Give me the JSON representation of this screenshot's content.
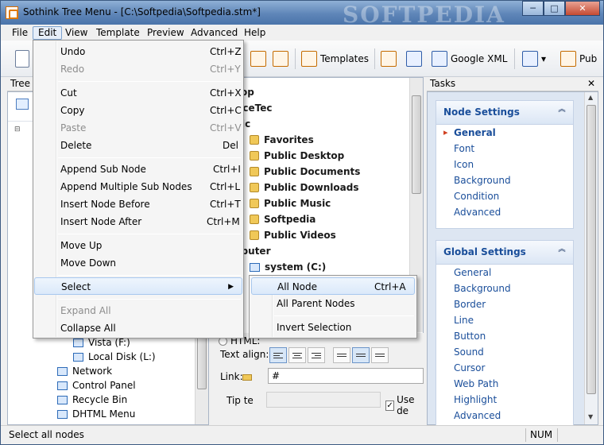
{
  "window": {
    "title": "Sothink Tree Menu - [C:\\Softpedia\\Softpedia.stm*]",
    "watermark": "SOFTPEDIA",
    "minimize": "─",
    "maximize": "□",
    "close": "✕"
  },
  "menubar": [
    "File",
    "Edit",
    "View",
    "Template",
    "Preview",
    "Advanced",
    "Help"
  ],
  "toolbar": {
    "templates_label": "Templates",
    "google_xml_label": "Google XML",
    "publish_label": "Pub",
    "dropdown_glyph": "▾"
  },
  "tree_panel": {
    "title": "Tree",
    "rows": [
      {
        "label": "Vista (F:)"
      },
      {
        "label": "Local Disk (L:)"
      },
      {
        "label": "Network"
      },
      {
        "label": "Control Panel"
      },
      {
        "label": "Recycle Bin"
      },
      {
        "label": "DHTML Menu"
      }
    ]
  },
  "preview_tree": {
    "rows": [
      "esktop",
      "SourceTec",
      "Public",
      "Favorites",
      "Public Desktop",
      "Public Documents",
      "Public Downloads",
      "Public Music",
      "Softpedia",
      "Public Videos",
      "Computer",
      "system (C:)"
    ]
  },
  "properties": {
    "html_label": "HTML:",
    "text_align_label": "Text align:",
    "link_label": "Link:",
    "link_value": "#",
    "tip_label": "Tip te",
    "use_default_label": "Use de"
  },
  "tasks_panel": {
    "title": "Tasks",
    "close": "✕",
    "node_settings": {
      "title": "Node Settings",
      "collapse": "︽",
      "items": [
        "General",
        "Font",
        "Icon",
        "Background",
        "Condition",
        "Advanced"
      ],
      "selected": "General"
    },
    "global_settings": {
      "title": "Global Settings",
      "collapse": "︽",
      "items": [
        "General",
        "Background",
        "Border",
        "Line",
        "Button",
        "Sound",
        "Cursor",
        "Web Path",
        "Highlight",
        "Advanced"
      ]
    }
  },
  "edit_menu": {
    "items": [
      {
        "label": "Undo",
        "shortcut": "Ctrl+Z",
        "disabled": false
      },
      {
        "label": "Redo",
        "shortcut": "Ctrl+Y",
        "disabled": true
      },
      {
        "label": "Cut",
        "shortcut": "Ctrl+X",
        "disabled": false
      },
      {
        "label": "Copy",
        "shortcut": "Ctrl+C",
        "disabled": false
      },
      {
        "label": "Paste",
        "shortcut": "Ctrl+V",
        "disabled": true
      },
      {
        "label": "Delete",
        "shortcut": "Del",
        "disabled": false
      },
      {
        "label": "Append Sub Node",
        "shortcut": "Ctrl+I",
        "disabled": false
      },
      {
        "label": "Append Multiple Sub Nodes",
        "shortcut": "Ctrl+L",
        "disabled": false
      },
      {
        "label": "Insert Node Before",
        "shortcut": "Ctrl+T",
        "disabled": false
      },
      {
        "label": "Insert Node After",
        "shortcut": "Ctrl+M",
        "disabled": false
      },
      {
        "label": "Move Up",
        "shortcut": "",
        "disabled": false
      },
      {
        "label": "Move Down",
        "shortcut": "",
        "disabled": false
      },
      {
        "label": "Select",
        "shortcut": "",
        "disabled": false
      },
      {
        "label": "Expand All",
        "shortcut": "",
        "disabled": true
      },
      {
        "label": "Collapse All",
        "shortcut": "",
        "disabled": false
      }
    ]
  },
  "select_submenu": {
    "items": [
      {
        "label": "All Node",
        "shortcut": "Ctrl+A"
      },
      {
        "label": "All Parent Nodes",
        "shortcut": ""
      },
      {
        "label": "Invert Selection",
        "shortcut": ""
      }
    ]
  },
  "status": {
    "message": "Select all nodes",
    "num": "NUM"
  }
}
